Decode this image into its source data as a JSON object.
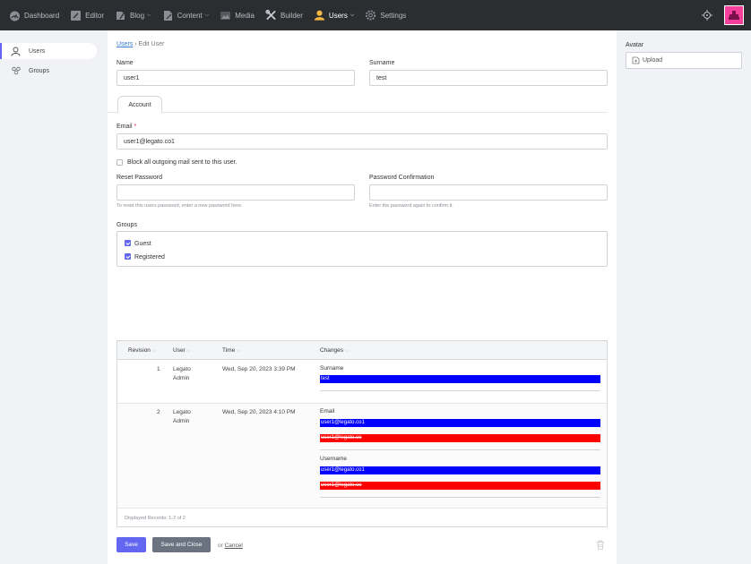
{
  "nav": {
    "items": [
      {
        "label": "Dashboard",
        "icon": "dashboard-icon"
      },
      {
        "label": "Editor",
        "icon": "editor-icon"
      },
      {
        "label": "Blog",
        "icon": "blog-icon"
      },
      {
        "label": "Content",
        "icon": "content-icon"
      },
      {
        "label": "Media",
        "icon": "media-icon"
      },
      {
        "label": "Builder",
        "icon": "builder-icon"
      },
      {
        "label": "Users",
        "icon": "users-icon"
      },
      {
        "label": "Settings",
        "icon": "settings-icon"
      }
    ]
  },
  "sidebar": {
    "items": [
      {
        "label": "Users",
        "icon": "user-icon"
      },
      {
        "label": "Groups",
        "icon": "groups-icon"
      }
    ]
  },
  "breadcrumb": {
    "parent": "Users",
    "separator": "›",
    "current": "Edit User"
  },
  "form": {
    "name_label": "Name",
    "name_value": "user1",
    "surname_label": "Surname",
    "surname_value": "test",
    "tab_account": "Account",
    "email_label": "Email",
    "email_required": "*",
    "email_value": "user1@legato.co1",
    "block_mail_label": "Block all outgoing mail sent to this user.",
    "reset_password_label": "Reset Password",
    "reset_password_hint": "To reset this users password, enter a new password here.",
    "password_confirm_label": "Password Confirmation",
    "password_confirm_hint": "Enter the password again to confirm it.",
    "groups_label": "Groups",
    "groups": [
      {
        "label": "Guest",
        "checked": true
      },
      {
        "label": "Registered",
        "checked": true
      }
    ]
  },
  "revisions": {
    "headers": {
      "revision": "Revision",
      "user": "User",
      "time": "Time",
      "changes": "Changes"
    },
    "rows": [
      {
        "revision": "1",
        "user_line1": "Legato",
        "user_line2": "Admin",
        "time": "Wed, Sep 20, 2023 3:39 PM",
        "changes": [
          {
            "field": "Surname",
            "new": "test"
          }
        ]
      },
      {
        "revision": "2",
        "user_line1": "Legato",
        "user_line2": "Admin",
        "time": "Wed, Sep 20, 2023 4:10 PM",
        "changes": [
          {
            "field": "Email",
            "new": "user1@legato.co1",
            "old": "user1@legato.co"
          },
          {
            "field": "Username",
            "new": "user1@legato.co1",
            "old": "user1@legato.co"
          }
        ]
      }
    ],
    "footer": "Displayed Records: 1-2 of 2"
  },
  "actions": {
    "save": "Save",
    "save_close": "Save and Close",
    "or": "or",
    "cancel": "Cancel"
  },
  "right_panel": {
    "avatar_label": "Avatar",
    "upload_label": "Upload"
  },
  "colors": {
    "accent": "#6366f1",
    "added": "#0000ff",
    "removed": "#ff0000",
    "user_avatar": "#f43f9c"
  }
}
